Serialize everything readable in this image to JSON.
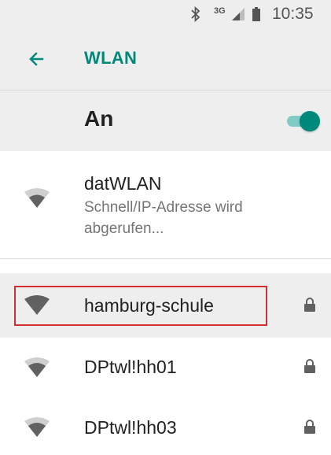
{
  "status_bar": {
    "bluetooth_icon": "bluetooth-icon",
    "network_type": "3G",
    "signal_icon": "signal-icon",
    "battery_icon": "battery-icon",
    "time": "10:35"
  },
  "toolbar": {
    "back_icon": "arrow-left-icon",
    "title": "WLAN"
  },
  "master_switch": {
    "label": "An",
    "state": "on"
  },
  "connected_network": {
    "ssid": "datWLAN",
    "status": "Schnell/IP-Adresse wird abgerufen..."
  },
  "networks": [
    {
      "ssid": "hamburg-schule",
      "secured": true,
      "highlighted": true
    },
    {
      "ssid": "DPtwl!hh01",
      "secured": true,
      "highlighted": false
    },
    {
      "ssid": "DPtwl!hh03",
      "secured": true,
      "highlighted": false
    }
  ],
  "colors": {
    "accent": "#00897b",
    "accent_light": "#80cbc4",
    "highlight_border": "#d32f2f",
    "header_bg": "#eeeeee"
  }
}
